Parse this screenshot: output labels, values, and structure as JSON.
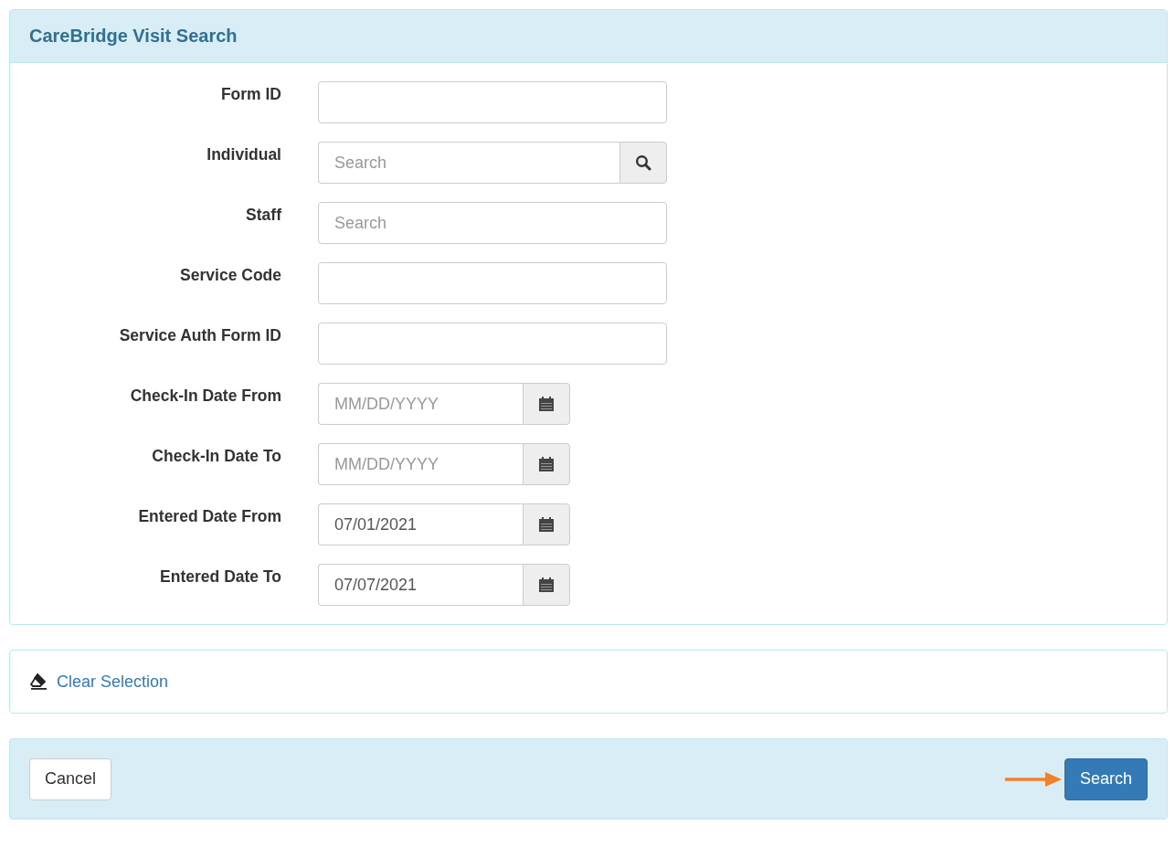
{
  "panel": {
    "title": "CareBridge Visit Search"
  },
  "fields": [
    {
      "label": "Form ID",
      "kind": "text"
    },
    {
      "label": "Individual",
      "kind": "lookup",
      "placeholder": "Search"
    },
    {
      "label": "Staff",
      "kind": "text",
      "placeholder": "Search"
    },
    {
      "label": "Service Code",
      "kind": "text"
    },
    {
      "label": "Service Auth Form ID",
      "kind": "text"
    },
    {
      "label": "Check-In Date From",
      "kind": "date",
      "placeholder": "MM/DD/YYYY"
    },
    {
      "label": "Check-In Date To",
      "kind": "date",
      "placeholder": "MM/DD/YYYY"
    },
    {
      "label": "Entered Date From",
      "kind": "date",
      "value": "07/01/2021"
    },
    {
      "label": "Entered Date To",
      "kind": "date",
      "value": "07/07/2021"
    }
  ],
  "clear_link": "Clear Selection",
  "footer": {
    "cancel": "Cancel",
    "search": "Search"
  }
}
